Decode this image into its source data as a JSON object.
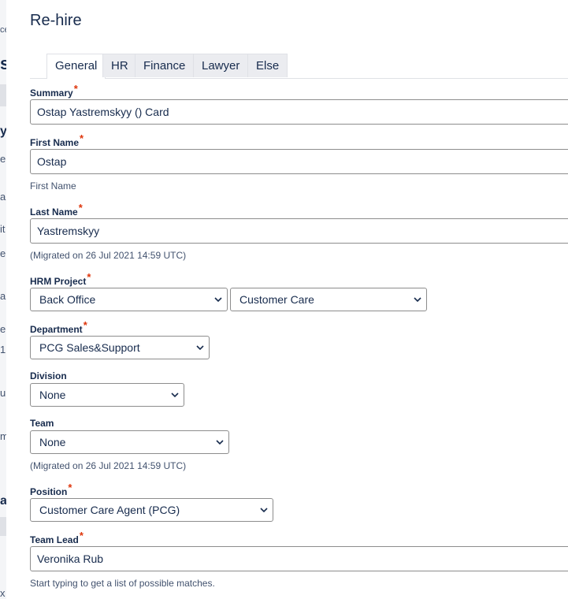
{
  "background_fragments": [
    "ce",
    "s",
    "y",
    "e",
    "a",
    "it",
    "e",
    "a",
    "er",
    "1",
    "u",
    "m",
    "a",
    "x"
  ],
  "dialog": {
    "title": "Re-hire"
  },
  "tabs": [
    {
      "label": "General",
      "active": true
    },
    {
      "label": "HR",
      "active": false
    },
    {
      "label": "Finance",
      "active": false
    },
    {
      "label": "Lawyer",
      "active": false
    },
    {
      "label": "Else",
      "active": false
    }
  ],
  "required_marker": "*",
  "fields": {
    "summary": {
      "label": "Summary",
      "value": "Ostap Yastremskyy () Card"
    },
    "first_name": {
      "label": "First Name",
      "value": "Ostap",
      "help": "First Name"
    },
    "last_name": {
      "label": "Last Name",
      "value": "Yastremskyy",
      "help": "(Migrated on 26 Jul 2021 14:59 UTC)"
    },
    "hrm_project": {
      "label": "HRM Project",
      "value_primary": "Back Office",
      "value_secondary": "Customer Care"
    },
    "department": {
      "label": "Department",
      "value": "PCG Sales&Support"
    },
    "division": {
      "label": "Division",
      "value": "None"
    },
    "team": {
      "label": "Team",
      "value": "None",
      "help": "(Migrated on 26 Jul 2021 14:59 UTC)"
    },
    "position": {
      "label": "Position",
      "value": "Customer Care Agent (PCG)"
    },
    "team_lead": {
      "label": "Team Lead",
      "value": "Veronika Rub",
      "help": "Start typing to get a list of possible matches."
    }
  },
  "colors": {
    "required": "#de350b",
    "text": "#172b4d",
    "tab_inactive_bg": "#ebecf0",
    "border": "#8d8d8d"
  }
}
